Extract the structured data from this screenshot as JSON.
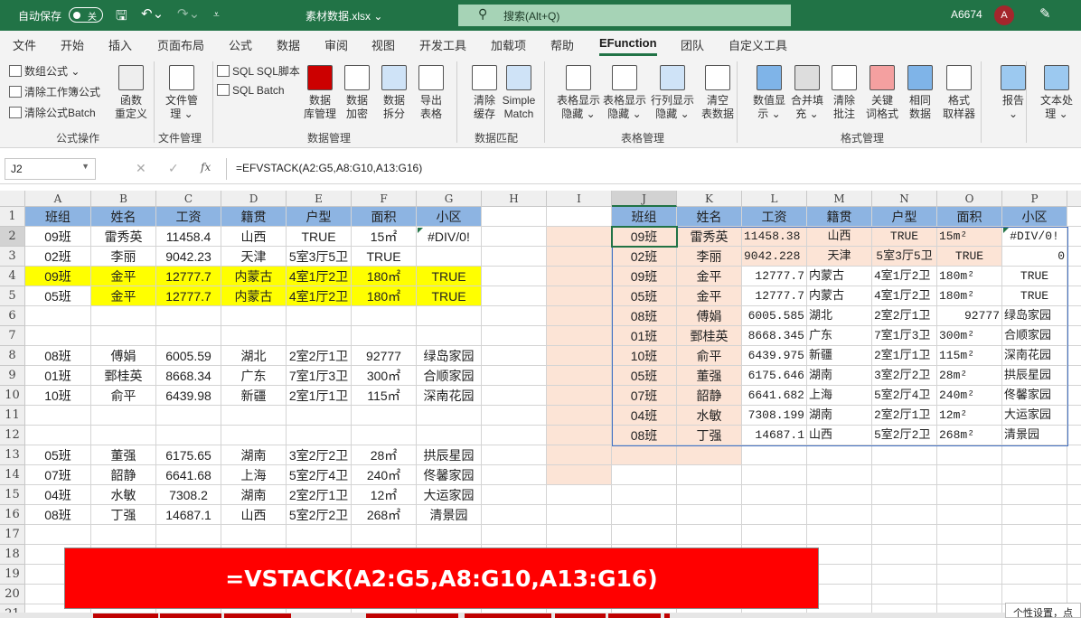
{
  "titlebar": {
    "autosave": "自动保存",
    "autosave_state": "关",
    "filename": "素材数据.xlsx ⌄",
    "search": "搜索(Alt+Q)",
    "user": "A6674",
    "avatar": "A"
  },
  "menu": [
    "文件",
    "开始",
    "插入",
    "页面布局",
    "公式",
    "数据",
    "审阅",
    "视图",
    "开发工具",
    "加载项",
    "帮助",
    "EFunction",
    "团队",
    "自定义工具"
  ],
  "active_menu": "EFunction",
  "ribbon": {
    "small": [
      "数组公式 ⌄",
      "清除工作簿公式",
      "清除公式Batch",
      "SQL SQL脚本",
      "SQL Batch"
    ],
    "buttons": [
      "函数\n重定义",
      "文件管\n理 ⌄",
      "数据\n库管理",
      "数据\n加密",
      "数据\n拆分",
      "导出\n表格",
      "清除\n缓存",
      "Simple\nMatch",
      "表格显示\n隐藏 ⌄",
      "表格显示\n隐藏 ⌄",
      "行列显示\n隐藏 ⌄",
      "清空\n表数据",
      "数值显\n示 ⌄",
      "合并填\n充 ⌄",
      "清除\n批注",
      "关键\n词格式",
      "相同\n数据",
      "格式\n取样器",
      "报告\n⌄",
      "文本处\n理 ⌄"
    ],
    "groups": [
      "公式操作",
      "文件管理",
      "数据管理",
      "数据匹配",
      "表格管理",
      "格式管理"
    ]
  },
  "formula_bar": {
    "name_box": "J2",
    "formula": "=EFVSTACK(A2:G5,A8:G10,A13:G16)"
  },
  "columns": [
    "A",
    "B",
    "C",
    "D",
    "E",
    "F",
    "G",
    "H",
    "I",
    "J",
    "K",
    "L",
    "M",
    "N",
    "O",
    "P"
  ],
  "colors": {
    "header_blue": "#8db4e2",
    "highlight_yellow": "#ffff00",
    "peach": "#fce4d6",
    "banner_red": "#ff0000",
    "excel_green": "#217346"
  },
  "left_table": [
    [
      "班组",
      "姓名",
      "工资",
      "籍贯",
      "户型",
      "面积",
      "小区"
    ],
    [
      "09班",
      "雷秀英",
      "11458.4",
      "山西",
      "TRUE",
      "15㎡",
      "#DIV/0!"
    ],
    [
      "02班",
      "李丽",
      "9042.23",
      "天津",
      "5室3厅5卫",
      "TRUE",
      ""
    ],
    [
      "09班",
      "金平",
      "12777.7",
      "内蒙古",
      "4室1厅2卫",
      "180㎡",
      "TRUE"
    ],
    [
      "05班",
      "金平",
      "12777.7",
      "内蒙古",
      "4室1厅2卫",
      "180㎡",
      "TRUE"
    ],
    [
      "",
      "",
      "",
      "",
      "",
      "",
      ""
    ],
    [
      "",
      "",
      "",
      "",
      "",
      "",
      ""
    ],
    [
      "08班",
      "傅娟",
      "6005.59",
      "湖北",
      "2室2厅1卫",
      "92777",
      "绿岛家园"
    ],
    [
      "01班",
      "鄄桂英",
      "8668.34",
      "广东",
      "7室1厅3卫",
      "300㎡",
      "合顺家园"
    ],
    [
      "10班",
      "俞平",
      "6439.98",
      "新疆",
      "2室1厅1卫",
      "115㎡",
      "深南花园"
    ],
    [
      "",
      "",
      "",
      "",
      "",
      "",
      ""
    ],
    [
      "",
      "",
      "",
      "",
      "",
      "",
      ""
    ],
    [
      "05班",
      "董强",
      "6175.65",
      "湖南",
      "3室2厅2卫",
      "28㎡",
      "拱辰星园"
    ],
    [
      "07班",
      "韶静",
      "6641.68",
      "上海",
      "5室2厅4卫",
      "240㎡",
      "佟馨家园"
    ],
    [
      "04班",
      "水敏",
      "7308.2",
      "湖南",
      "2室2厅1卫",
      "12㎡",
      "大运家园"
    ],
    [
      "08班",
      "丁强",
      "14687.1",
      "山西",
      "5室2厅2卫",
      "268㎡",
      "清景园"
    ]
  ],
  "right_table": [
    [
      "班组",
      "姓名",
      "工资",
      "籍贯",
      "户型",
      "面积",
      "小区"
    ],
    [
      "09班",
      "雷秀英",
      "11458.38",
      "山西",
      "TRUE",
      "15m²",
      "#DIV/0!"
    ],
    [
      "02班",
      "李丽",
      "9042.228",
      "天津",
      "5室3厅5卫",
      "TRUE",
      "0"
    ],
    [
      "09班",
      "金平",
      "12777.7",
      "内蒙古",
      "4室1厅2卫",
      "180m²",
      "TRUE"
    ],
    [
      "05班",
      "金平",
      "12777.7",
      "内蒙古",
      "4室1厅2卫",
      "180m²",
      "TRUE"
    ],
    [
      "08班",
      "傅娟",
      "6005.585",
      "湖北",
      "2室2厅1卫",
      "92777",
      "绿岛家园"
    ],
    [
      "01班",
      "鄄桂英",
      "8668.345",
      "广东",
      "7室1厅3卫",
      "300m²",
      "合顺家园"
    ],
    [
      "10班",
      "俞平",
      "6439.975",
      "新疆",
      "2室1厅1卫",
      "115m²",
      "深南花园"
    ],
    [
      "05班",
      "董强",
      "6175.646",
      "湖南",
      "3室2厅2卫",
      "28m²",
      "拱辰星园"
    ],
    [
      "07班",
      "韶静",
      "6641.682",
      "上海",
      "5室2厅4卫",
      "240m²",
      "佟馨家园"
    ],
    [
      "04班",
      "水敏",
      "7308.199",
      "湖南",
      "2室2厅1卫",
      "12m²",
      "大运家园"
    ],
    [
      "08班",
      "丁强",
      "14687.1",
      "山西",
      "5室2厅2卫",
      "268m²",
      "清景园"
    ]
  ],
  "banner": "=VSTACK(A2:G5,A8:G10,A13:G16)",
  "tooltip": "个性设置，点"
}
